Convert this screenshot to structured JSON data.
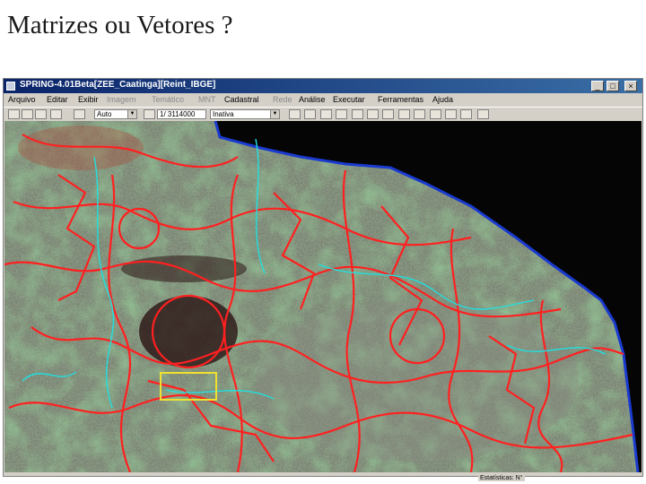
{
  "slide": {
    "title": "Matrizes ou Vetores ?"
  },
  "window": {
    "title": "SPRING-4.01Beta[ZEE_Caatinga][Reint_IBGE]",
    "controls": [
      "_",
      "□",
      "×"
    ]
  },
  "menu": [
    {
      "label": "Arquivo",
      "enabled": true
    },
    {
      "label": "Editar",
      "enabled": true
    },
    {
      "label": "Exibir",
      "enabled": true
    },
    {
      "label": "Imagem",
      "enabled": false
    },
    {
      "label": "Temático",
      "enabled": false
    },
    {
      "label": "MNT",
      "enabled": false
    },
    {
      "label": "Cadastral",
      "enabled": true
    },
    {
      "label": "Rede",
      "enabled": false
    },
    {
      "label": "Análise",
      "enabled": true
    },
    {
      "label": "Executar",
      "enabled": true
    },
    {
      "label": "Ferramentas",
      "enabled": true
    },
    {
      "label": "Ajuda",
      "enabled": true
    }
  ],
  "toolbar": {
    "zoom_value": "Auto",
    "scale_value": "1/ 3114000",
    "layer_value": "Inativa"
  },
  "status": {
    "scale_label": "Estatísticas: N°"
  },
  "colors": {
    "map_boundaries": "#ff2020",
    "rivers": "#20e0e0",
    "selection_box": "#f0e030",
    "ocean": "#050505"
  }
}
